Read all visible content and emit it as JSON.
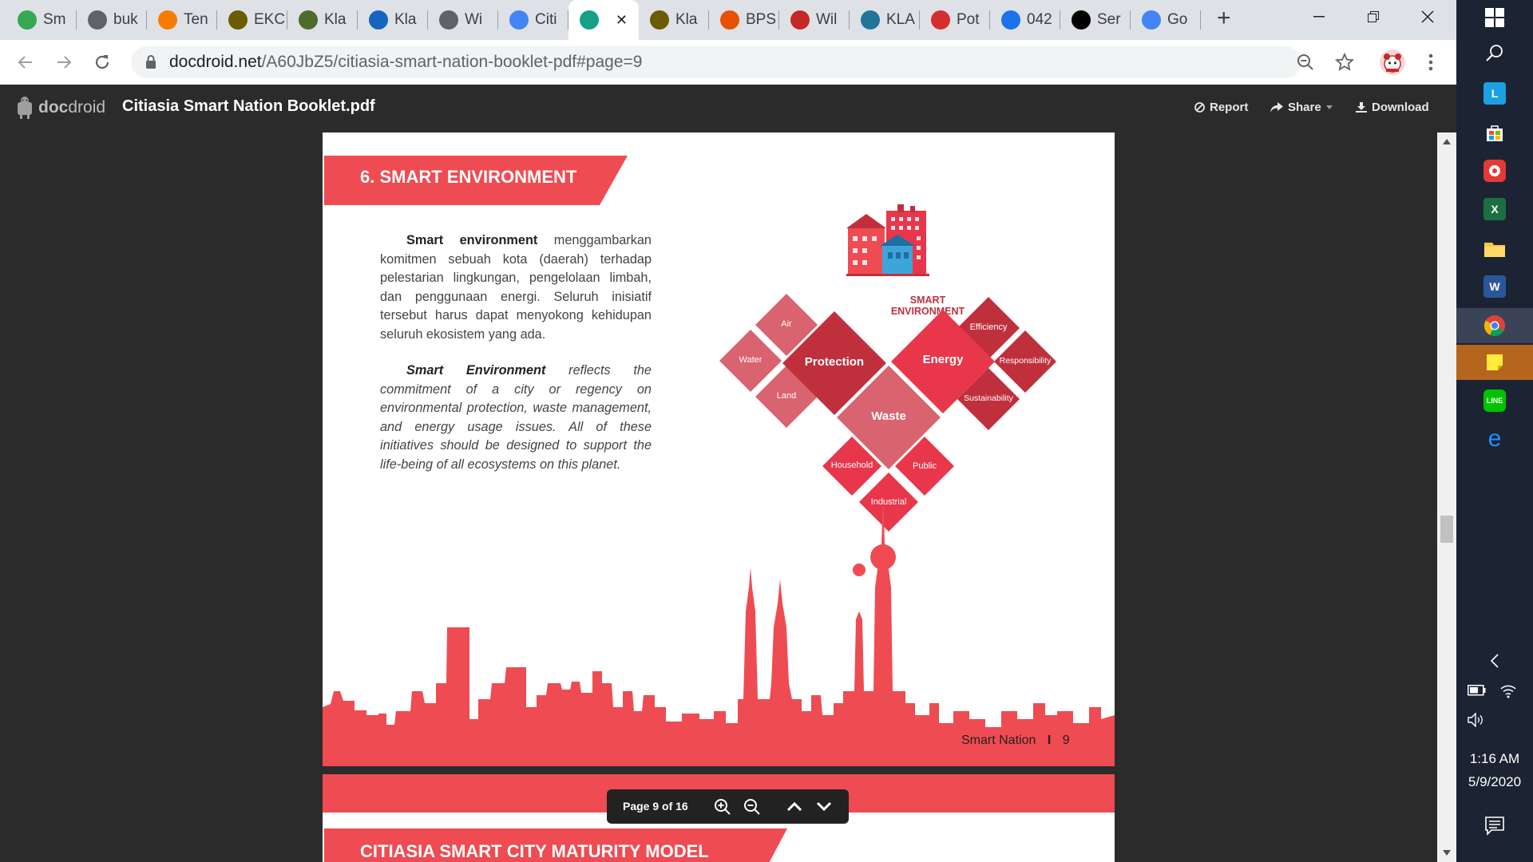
{
  "browser": {
    "tabs": [
      {
        "label": "Sm",
        "icon": "wifi-icon",
        "color": "#34a853"
      },
      {
        "label": "buk",
        "icon": "globe-icon",
        "color": "#5f6368"
      },
      {
        "label": "Ten",
        "icon": "tokopedia-icon",
        "color": "#f57c00"
      },
      {
        "label": "EKC",
        "icon": "shield-crest-icon",
        "color": "#6d5b00"
      },
      {
        "label": "Kla",
        "icon": "crest-icon",
        "color": "#4e6b2f"
      },
      {
        "label": "Kla",
        "icon": "jp-icon",
        "color": "#1565c0"
      },
      {
        "label": "Wi",
        "icon": "globe-icon",
        "color": "#5f6368"
      },
      {
        "label": "Citi",
        "icon": "google-icon",
        "color": "#4285f4"
      },
      {
        "label": "",
        "icon": "docdroid-icon",
        "color": "#16a085",
        "active": true
      },
      {
        "label": "Kla",
        "icon": "shield-crest-icon",
        "color": "#6d5b00"
      },
      {
        "label": "BPS",
        "icon": "bps-icon",
        "color": "#e65100"
      },
      {
        "label": "Wil",
        "icon": "waveform-icon",
        "color": "#c62828"
      },
      {
        "label": "KLA",
        "icon": "wordpress-icon",
        "color": "#21759b"
      },
      {
        "label": "Pot",
        "icon": "red-square-icon",
        "color": "#d32f2f"
      },
      {
        "label": "042",
        "icon": "document-icon",
        "color": "#1a73e8"
      },
      {
        "label": "Ser",
        "icon": "wikipedia-icon",
        "color": "#000000"
      },
      {
        "label": "Go",
        "icon": "google-translate-icon",
        "color": "#4285f4"
      }
    ],
    "new_tab_glyph": "+",
    "close_glyph": "✕",
    "url_host": "docdroid.net",
    "url_path": "/A60JbZ5/citiasia-smart-nation-booklet-pdf#page=9"
  },
  "docdroid": {
    "logo_text_bold": "doc",
    "logo_text_light": "droid",
    "title": "Citiasia Smart Nation Booklet.pdf",
    "report": "Report",
    "share": "Share",
    "download": "Download"
  },
  "page": {
    "heading": "6. SMART ENVIRONMENT",
    "para1_lead": "Smart environment",
    "para1_rest": " menggambarkan komitmen sebuah kota (daerah) terhadap pelestarian lingkungan, pengelolaan limbah, dan penggunaan energi. Seluruh inisiatif tersebut harus dapat menyokong kehidupan seluruh ekosistem yang ada.",
    "para2_lead": "Smart Environment",
    "para2_rest": " reflects the commitment of a city or regency on environmental protection, waste management, and energy usage issues. All of these initiatives should be designed to support the life-being of all ecosystems on this planet.",
    "diagram": {
      "label_line1": "SMART",
      "label_line2": "ENVIRONMENT",
      "protection": "Protection",
      "energy": "Energy",
      "waste": "Waste",
      "air": "Air",
      "water": "Water",
      "land": "Land",
      "efficiency": "Efficiency",
      "responsibility": "Responsibility",
      "sustainability": "Sustainability",
      "household": "Household",
      "public": "Public",
      "industrial": "Industrial"
    },
    "footer_label": "Smart Nation",
    "footer_sep": "I",
    "footer_page": "9",
    "next_heading": "CITIASIA SMART CITY MATURITY MODEL"
  },
  "toolbar": {
    "page_indicator": "Page 9 of 16"
  },
  "taskbar": {
    "time": "1:16 AM",
    "date": "5/9/2020"
  },
  "colors": {
    "accent_red": "#ef4b52",
    "dark_red": "#c0303c",
    "mid_red": "#e8364a",
    "pink": "#d9636e"
  }
}
